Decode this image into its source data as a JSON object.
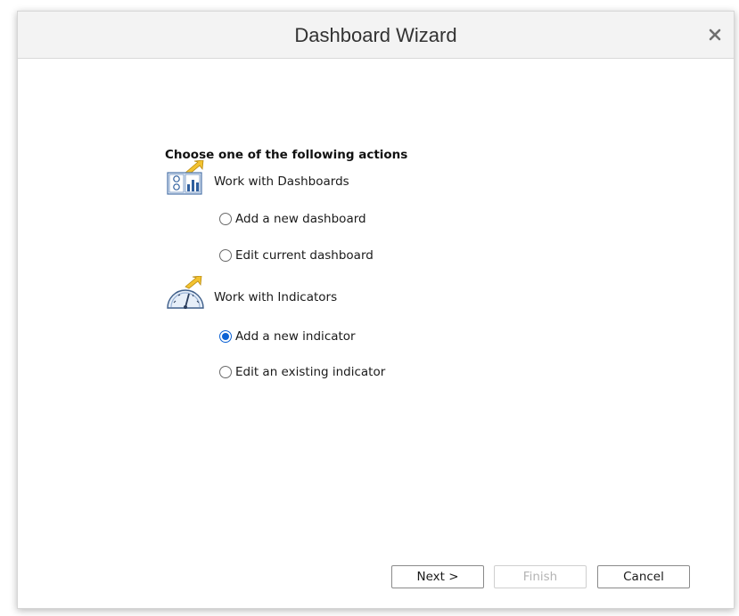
{
  "dialog": {
    "title": "Dashboard Wizard",
    "close_icon": "close-icon"
  },
  "content": {
    "heading": "Choose one of the following actions",
    "sections": [
      {
        "label": "Work with Dashboards",
        "icon": "dashboard-icon",
        "options": [
          {
            "label": "Add a new dashboard",
            "checked": false
          },
          {
            "label": "Edit current dashboard",
            "checked": false
          }
        ]
      },
      {
        "label": "Work with Indicators",
        "icon": "indicator-gauge-icon",
        "options": [
          {
            "label": "Add a new indicator",
            "checked": true
          },
          {
            "label": "Edit an existing indicator",
            "checked": false
          }
        ]
      }
    ]
  },
  "buttons": {
    "next": "Next >",
    "finish": "Finish",
    "cancel": "Cancel"
  },
  "colors": {
    "accent": "#0c62d4",
    "titlebar": "#f3f3f3"
  }
}
